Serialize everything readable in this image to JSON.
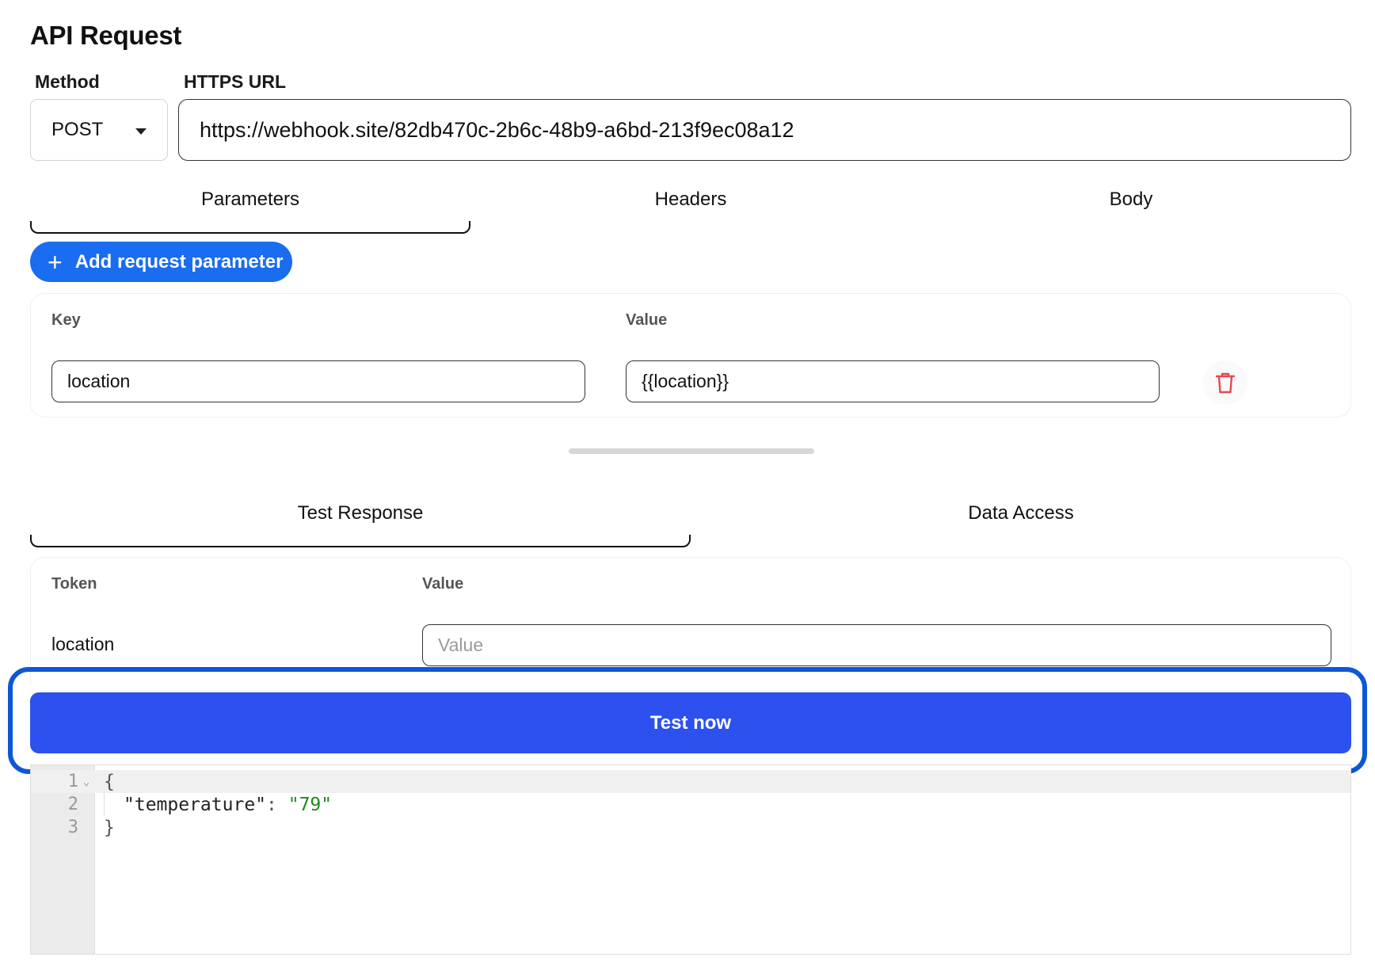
{
  "page": {
    "title": "API Request"
  },
  "request": {
    "method_label": "Method",
    "method_value": "POST",
    "url_label": "HTTPS URL",
    "url_value": "https://webhook.site/82db470c-2b6c-48b9-a6bd-213f9ec08a12"
  },
  "request_tabs": [
    {
      "label": "Parameters",
      "active": true
    },
    {
      "label": "Headers",
      "active": false
    },
    {
      "label": "Body",
      "active": false
    }
  ],
  "parameters": {
    "add_button_label": "Add request parameter",
    "key_header": "Key",
    "value_header": "Value",
    "rows": [
      {
        "key": "location",
        "value": "{{location}}"
      }
    ]
  },
  "test_tabs": [
    {
      "label": "Test Response",
      "active": true
    },
    {
      "label": "Data Access",
      "active": false
    }
  ],
  "tokens": {
    "token_header": "Token",
    "value_header": "Value",
    "rows": [
      {
        "token": "location",
        "value": "",
        "placeholder": "Value"
      }
    ]
  },
  "test_button_label": "Test now",
  "response_editor": {
    "lines": [
      {
        "no": "1",
        "open": "{"
      },
      {
        "no": "2",
        "key": "\"temperature\"",
        "sep": ": ",
        "value": "\"79\""
      },
      {
        "no": "3",
        "close": "}"
      }
    ]
  },
  "colors": {
    "accent_blue": "#1a6cf0",
    "test_button": "#2c51ee",
    "highlight_outline": "#0d57d6",
    "delete_red": "#e5484d",
    "json_string": "#1a8a1a"
  }
}
